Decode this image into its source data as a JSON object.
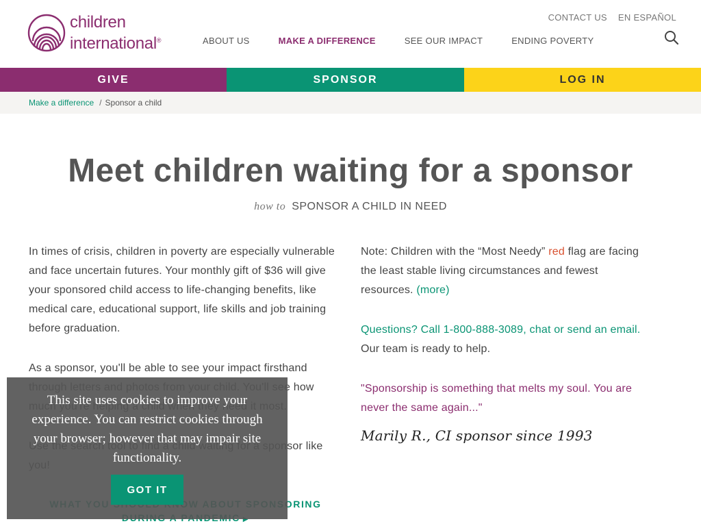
{
  "brand": {
    "name_line1": "children",
    "name_line2": "international",
    "registered": "®",
    "logo_icon": "concentric-arches-logo",
    "colors": {
      "purple": "#8b2d6f",
      "green": "#0a9474",
      "yellow": "#fcd319"
    }
  },
  "utility_nav": {
    "contact": "CONTACT US",
    "spanish": "EN ESPAÑOL"
  },
  "main_nav": {
    "items": [
      {
        "label": "ABOUT US",
        "active": false
      },
      {
        "label": "MAKE A DIFFERENCE",
        "active": true
      },
      {
        "label": "SEE OUR IMPACT",
        "active": false
      },
      {
        "label": "ENDING POVERTY",
        "active": false
      }
    ],
    "search_icon": "search-icon"
  },
  "action_bar": {
    "give": "GIVE",
    "sponsor": "SPONSOR",
    "login": "LOG IN"
  },
  "breadcrumb": {
    "parent": "Make a difference",
    "separator": "/",
    "current": "Sponsor a child"
  },
  "page": {
    "title": "Meet children waiting for a sponsor",
    "subtitle_prefix": "how to",
    "subtitle": "SPONSOR A CHILD IN NEED"
  },
  "left_column": {
    "para1": "In times of crisis, children in poverty are especially vulnerable and face uncertain futures. Your monthly gift of $36 will give your sponsored child access to life-changing benefits, like medical care, educational support, life skills and job training before graduation.",
    "para2": "As a sponsor, you'll be able to see your impact firsthand through letters and photos from your child. You'll see how much you're helping a child when they need it most.",
    "para3": "Use the search tool to find a child waiting for a sponsor like you!",
    "pandemic_link": "WHAT YOU SHOULD KNOW ABOUT SPONSORING DURING A PANDEMIC"
  },
  "right_column": {
    "note_prefix": "Note: Children with the “Most Needy”",
    "note_red": "red",
    "note_suffix": "flag are facing the least stable living circumstances and fewest resources.",
    "note_more": "(more)",
    "questions_link": "Questions? Call 1-800-888-3089, chat or send an email.",
    "questions_suffix": "Our team is ready to help.",
    "quote": "\"Sponsorship is something that melts my soul. You are never the same again...\"",
    "signature": "Marily R., CI sponsor since 1993"
  },
  "cookie_banner": {
    "text": "This site uses cookies to improve your experience. You can restrict cookies through your browser; however that may impair site functionality.",
    "button": "GOT IT"
  }
}
